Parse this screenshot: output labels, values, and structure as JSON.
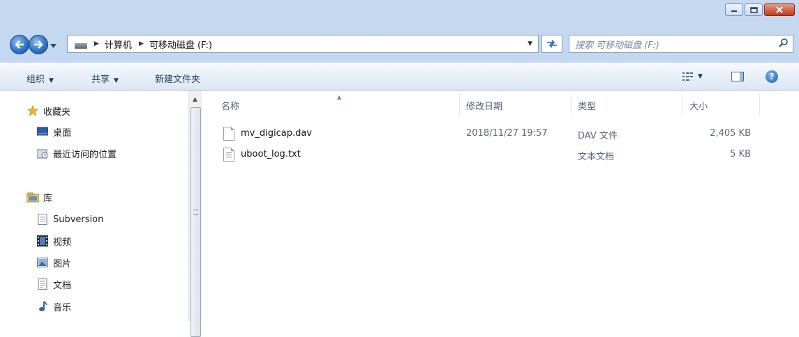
{
  "window": {
    "caption_buttons": [
      "minimize",
      "maximize",
      "close"
    ]
  },
  "address": {
    "crumbs": [
      "计算机",
      "可移动磁盘 (F:)"
    ],
    "search_placeholder": "搜索 可移动磁盘 (F:)"
  },
  "toolbar": {
    "organize": "组织",
    "share": "共享",
    "new_folder": "新建文件夹"
  },
  "nav": {
    "favorites": "收藏夹",
    "desktop": "桌面",
    "recent": "最近访问的位置",
    "libraries": "库",
    "subversion": "Subversion",
    "videos": "视频",
    "pictures": "图片",
    "documents": "文档",
    "music": "音乐"
  },
  "columns": {
    "name": "名称",
    "modified": "修改日期",
    "type": "类型",
    "size": "大小"
  },
  "files": [
    {
      "name": "mv_digicap.dav",
      "modified": "2018/11/27 19:57",
      "type": "DAV 文件",
      "size": "2,405 KB",
      "icon": "blank-file-icon"
    },
    {
      "name": "uboot_log.txt",
      "modified": "",
      "type": "文本文档",
      "size": "5 KB",
      "icon": "text-file-icon"
    }
  ]
}
